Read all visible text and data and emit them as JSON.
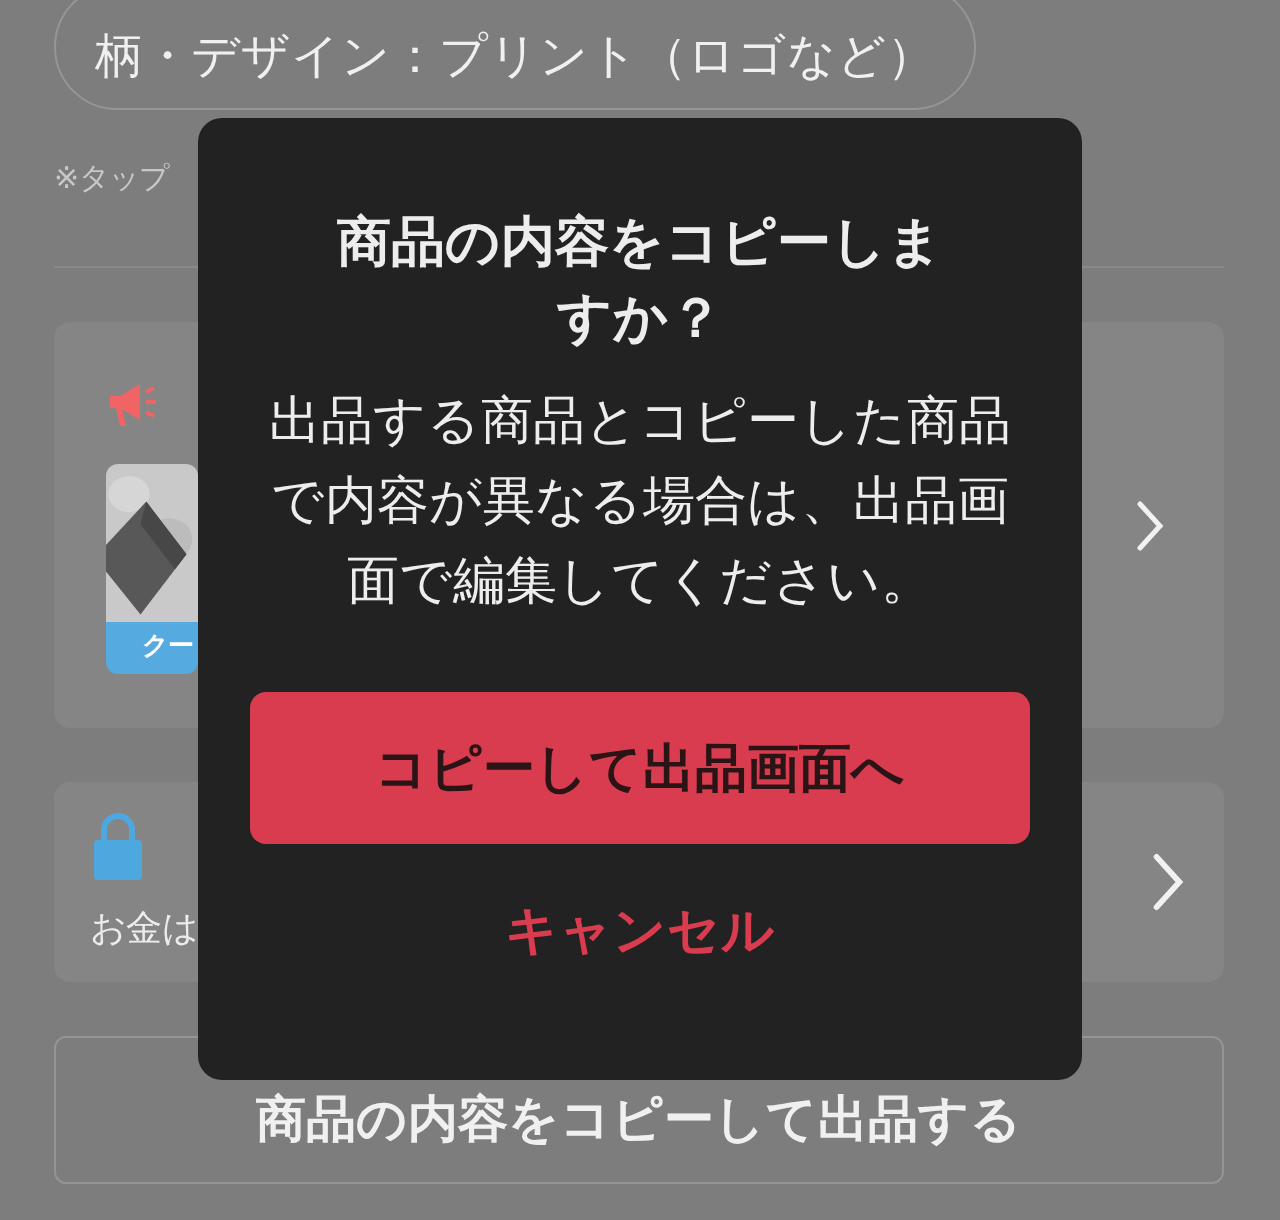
{
  "chip": {
    "label": "柄・デザイン：プリント（ロゴなど）"
  },
  "note": "※タップ",
  "cards": [
    {
      "kind": "promo",
      "thumbnail": {
        "kind": "picture",
        "label": "クー"
      }
    },
    {
      "kind": "secure",
      "text": "お金は"
    }
  ],
  "action_button": {
    "label": "商品の内容をコピーして出品する"
  },
  "dialog": {
    "title": "商品の内容をコピーしますか？",
    "message": "出品する商品とコピーした商品で内容が異なる場合は、出品画面で編集してください。",
    "buttons": [
      {
        "kind": "primary",
        "label": "コピーして出品画面へ"
      },
      {
        "kind": "cancel",
        "label": "キャンセル"
      }
    ]
  }
}
